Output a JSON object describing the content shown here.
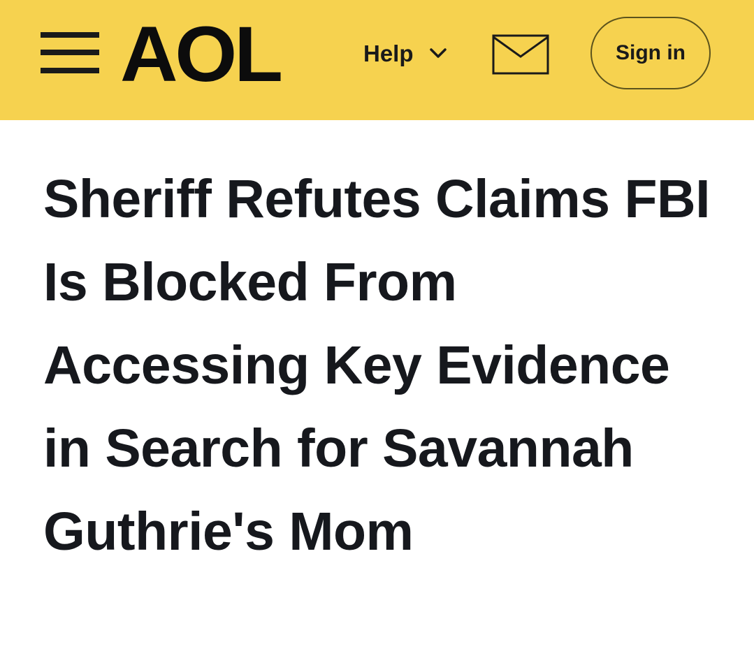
{
  "header": {
    "background_color": "#f6d24f",
    "menu_icon": "hamburger-menu-icon",
    "logo_text": "AOL",
    "help_label": "Help",
    "help_chevron_icon": "chevron-down-icon",
    "mail_icon": "envelope-icon",
    "sign_in_label": "Sign in"
  },
  "article": {
    "headline": "Sheriff Refutes Claims FBI Is Blocked From Accessing Key Evidence in Search for Savannah Guthrie's Mom"
  }
}
